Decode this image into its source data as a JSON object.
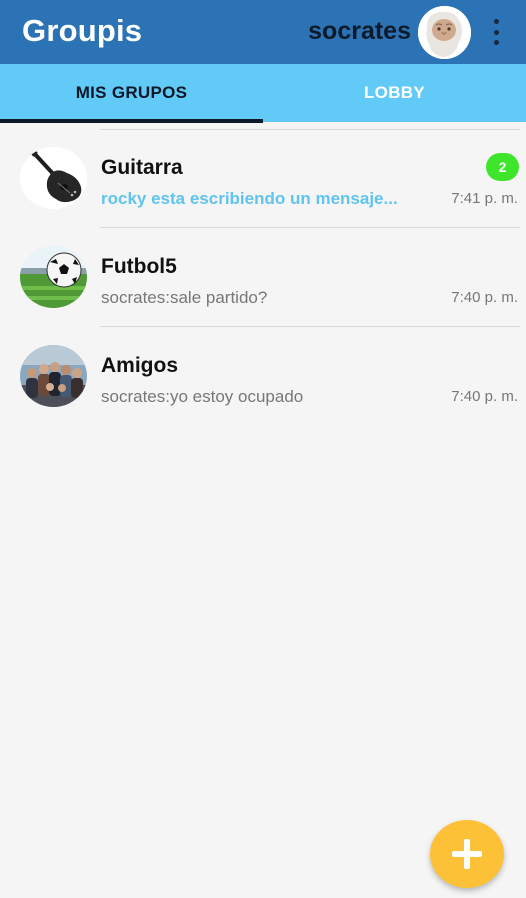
{
  "app": {
    "title": "Groupis",
    "username": "socrates",
    "colors": {
      "toolbar": "#2b73b4",
      "tabs": "#62caf6",
      "typing": "#5fc4ef",
      "badge": "#3ee52b",
      "fab": "#fcc137"
    }
  },
  "tabs": [
    {
      "label": "MIS GRUPOS",
      "active": true
    },
    {
      "label": "LOBBY",
      "active": false
    }
  ],
  "groups": [
    {
      "name": "Guitarra",
      "last_message": "rocky esta escribiendo un mensaje...",
      "typing": true,
      "time": "7:41 p. m.",
      "unread": "2",
      "icon": "guitar-icon"
    },
    {
      "name": "Futbol5",
      "last_message": "socrates:sale partido?",
      "typing": false,
      "time": "7:40 p. m.",
      "icon": "soccer-ball-icon"
    },
    {
      "name": "Amigos",
      "last_message": "socrates:yo estoy ocupado",
      "typing": false,
      "time": "7:40 p. m.",
      "icon": "group-photo-icon"
    }
  ],
  "fab": {
    "icon": "plus-icon"
  }
}
